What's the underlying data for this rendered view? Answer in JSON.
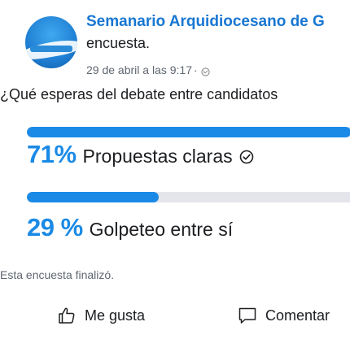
{
  "post": {
    "author": "Semanario Arquidiocesano de G",
    "subline": "encuesta.",
    "timestamp": "29 de abril a las 9:17",
    "separator": "·",
    "privacy_icon": "globe-icon"
  },
  "poll": {
    "question": "¿Qué esperas del debate entre candidatos",
    "options": [
      {
        "percent_label": "71%",
        "label": "Propuestas claras",
        "fraction": 0.71,
        "selected": true
      },
      {
        "percent_label": "29 %",
        "label": "Golpeteo entre sí",
        "fraction": 0.29,
        "selected": false
      }
    ],
    "status": "Esta encuesta finalizó."
  },
  "actions": {
    "like_label": "Me gusta",
    "comment_label": "Comentar"
  },
  "colors": {
    "accent": "#1b8ae6",
    "author": "#1877d2",
    "track": "#e4e6eb",
    "muted": "#606770"
  }
}
